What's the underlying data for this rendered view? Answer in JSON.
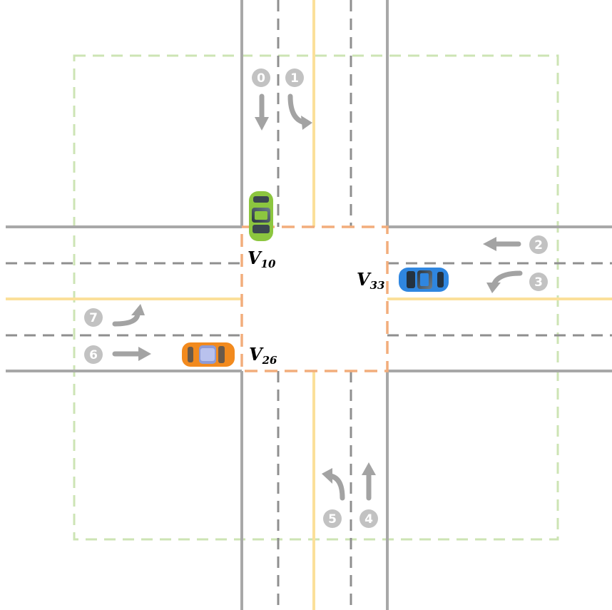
{
  "colors": {
    "road_edge": "#a8a8a8",
    "lane_divider": "#8f8f8f",
    "center_line": "#fbe09a",
    "region_border": "#cde4b4",
    "conflict_zone": "#f2ad7c",
    "arrow": "#a3a3a3",
    "lane_badge": "#c2c2c2"
  },
  "lanes": [
    {
      "id": "0",
      "movement": "straight",
      "icon": "down-arrow-icon"
    },
    {
      "id": "1",
      "movement": "left-turn",
      "icon": "turn-arrow-icon"
    },
    {
      "id": "2",
      "movement": "straight",
      "icon": "left-arrow-icon"
    },
    {
      "id": "3",
      "movement": "left-turn",
      "icon": "turn-arrow-icon"
    },
    {
      "id": "4",
      "movement": "straight",
      "icon": "up-arrow-icon"
    },
    {
      "id": "5",
      "movement": "left-turn",
      "icon": "turn-arrow-icon"
    },
    {
      "id": "6",
      "movement": "straight",
      "icon": "right-arrow-icon"
    },
    {
      "id": "7",
      "movement": "left-turn",
      "icon": "turn-arrow-icon"
    }
  ],
  "vehicles": [
    {
      "label": "V",
      "sub": "10",
      "color": "#8cc63f",
      "icon": "green-car-icon"
    },
    {
      "label": "V",
      "sub": "33",
      "color": "#2f86e0",
      "icon": "blue-car-icon"
    },
    {
      "label": "V",
      "sub": "26",
      "color": "#f28a1e",
      "icon": "orange-car-icon"
    }
  ]
}
